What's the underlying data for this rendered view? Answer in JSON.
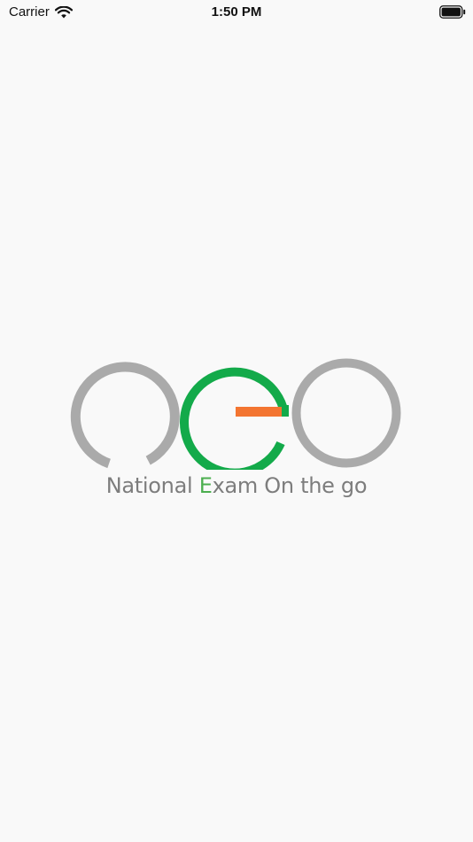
{
  "status_bar": {
    "carrier": "Carrier",
    "time": "1:50 PM"
  },
  "splash": {
    "tagline_before": "National ",
    "tagline_accent": "E",
    "tagline_after": "xam On the go",
    "colors": {
      "grey_ring": "#aaaaaa",
      "green_ring": "#13aa4a",
      "orange_bar": "#f37531",
      "tagline_text": "#7d7d7d",
      "tagline_accent": "#4cae4f"
    }
  }
}
